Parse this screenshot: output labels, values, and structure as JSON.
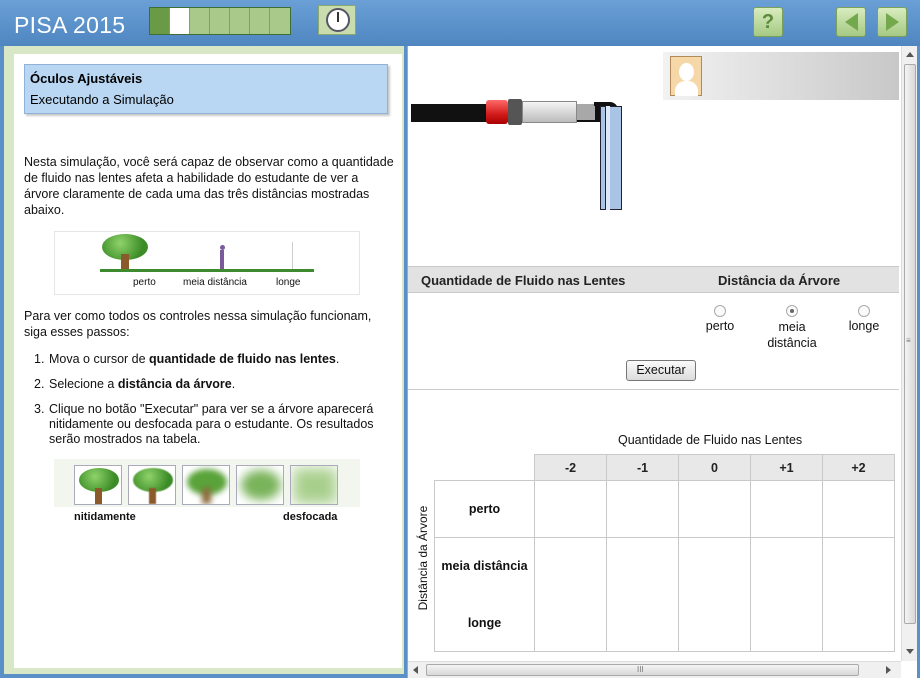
{
  "header": {
    "title": "PISA 2015",
    "progress": {
      "total": 7,
      "done": 1,
      "current": 2
    },
    "help_label": "?",
    "icons": {
      "timer": "clock-icon",
      "help": "question-icon",
      "prev": "arrow-left-icon",
      "next": "arrow-right-icon"
    },
    "colors": {
      "bar": "#5b8fc7",
      "nav": "#74a84c"
    }
  },
  "left": {
    "unit_title": "Óculos Ajustáveis",
    "unit_subtitle": "Executando a Simulação",
    "intro": "Nesta simulação, você será capaz de observar como a quantidade de fluido nas lentes afeta a habilidade do estudante de ver a árvore claramente de cada uma das três distâncias mostradas abaixo.",
    "distances": {
      "near": "perto",
      "mid": "meia distância",
      "far": "longe"
    },
    "steps_intro": "Para ver como todos os controles nessa simulação funcionam, siga esses passos:",
    "steps": [
      {
        "num": "1.",
        "pre": "Mova o cursor de ",
        "bold": "quantidade de fluido nas lentes",
        "post": "."
      },
      {
        "num": "2.",
        "pre": "Selecione a ",
        "bold": "distância da árvore",
        "post": "."
      },
      {
        "num": "3.",
        "pre": "Clique no botão \"Executar\" para ver se a árvore aparecerá nitidamente ou desfocada para o estudante. Os resultados serão mostrados na tabela.",
        "bold": "",
        "post": ""
      }
    ],
    "blur_scale": {
      "sharp": "nitidamente",
      "blurred": "desfocada"
    }
  },
  "sim": {
    "header_fluid": "Quantidade de Fluido nas Lentes",
    "header_distance": "Distância da Árvore",
    "radios": [
      {
        "label": "perto",
        "checked": false
      },
      {
        "label": "meia distância",
        "checked": true
      },
      {
        "label": "longe",
        "checked": false
      }
    ],
    "execute_label": "Executar",
    "table_title": "Quantidade de Fluido nas Lentes",
    "row_axis_title": "Distância da Árvore",
    "columns": [
      "-2",
      "-1",
      "0",
      "+1",
      "+2"
    ],
    "rows": [
      "perto",
      "meia distância",
      "longe"
    ],
    "scroll_grip": "III",
    "scroll_grip_v": "≡"
  }
}
